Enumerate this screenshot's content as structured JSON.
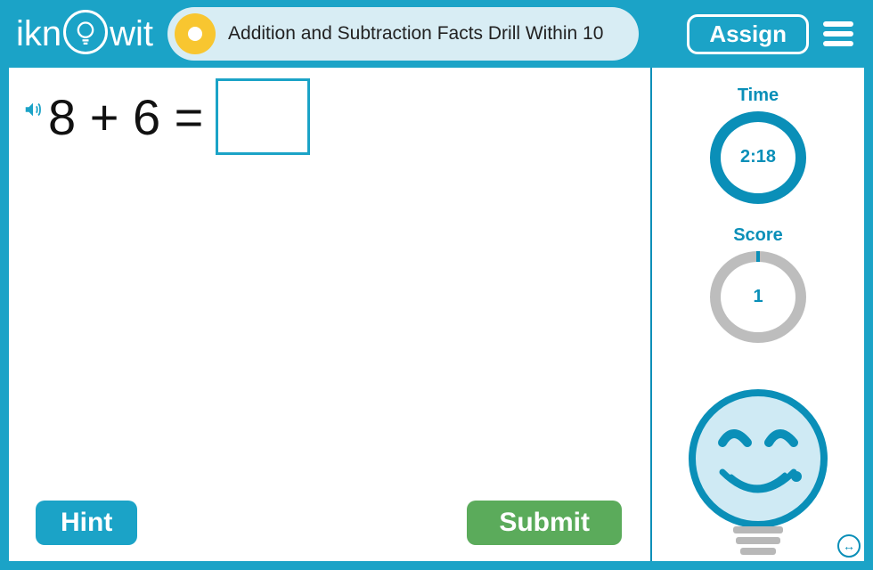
{
  "header": {
    "logo_left": "ikn",
    "logo_right": "wit",
    "title": "Addition and Subtraction Facts Drill Within 10",
    "assign_label": "Assign"
  },
  "question": {
    "expression": "8 + 6 =",
    "answer_value": ""
  },
  "buttons": {
    "hint": "Hint",
    "submit": "Submit"
  },
  "side": {
    "time_label": "Time",
    "time_value": "2:18",
    "score_label": "Score",
    "score_value": "1"
  }
}
